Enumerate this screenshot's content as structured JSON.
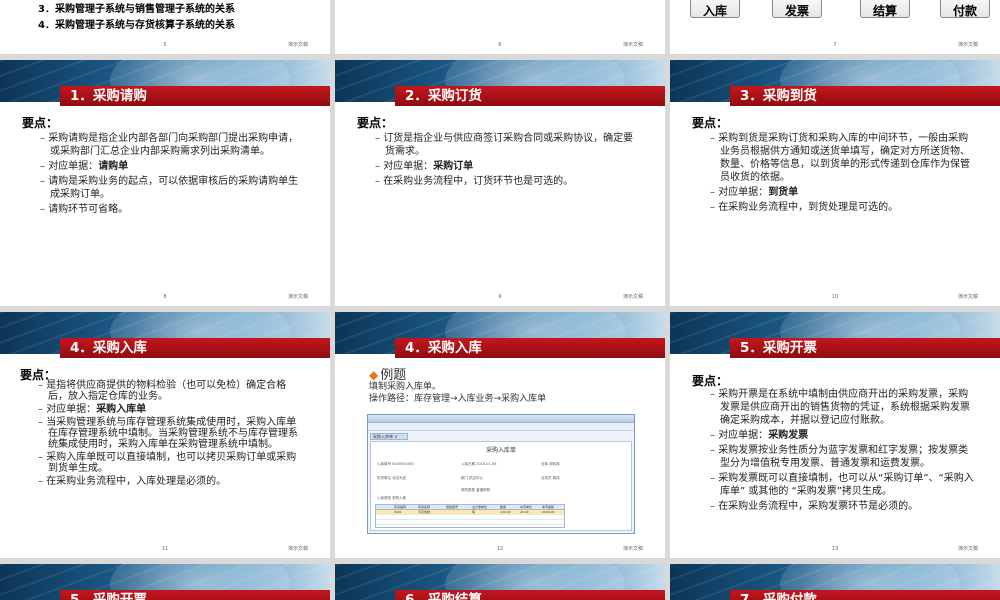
{
  "common": {
    "watermark": "演示文稿"
  },
  "slides": [
    {
      "num": "5",
      "items": [
        "3．采购管理子系统与销售管理子系统的关系",
        "4．采购管理子系统与存货核算子系统的关系"
      ]
    },
    {
      "num": "6"
    },
    {
      "num": "7",
      "process": [
        "入库",
        "发票",
        "结算",
        "付款"
      ]
    },
    {
      "num": "8",
      "title": "1．采购请购",
      "heading": "要点：",
      "points": [
        "采购请购是指企业内部各部门向采购部门提出采购申请，或采购部门汇总企业内部采购需求列出采购清单。",
        "对应单据：",
        "请购单",
        "请购是采购业务的起点，可以依据审核后的采购请购单生成采购订单。",
        "请购环节可省略。"
      ]
    },
    {
      "num": "9",
      "title": "2．采购订货",
      "heading": "要点：",
      "points": [
        "订货是指企业与供应商签订采购合同或采购协议，确定要货需求。",
        "对应单据：",
        "采购订单",
        "在采购业务流程中，订货环节也是可选的。"
      ]
    },
    {
      "num": "10",
      "title": "3．采购到货",
      "heading": "要点：",
      "points": [
        "采购到货是采购订货和采购入库的中间环节，一般由采购业务员根据供方通知或送货单填写，确定对方所送货物、数量、价格等信息，以到货单的形式传递到仓库作为保管员收货的依据。",
        "对应单据：",
        "到货单",
        "在采购业务流程中，到货处理是可选的。"
      ]
    },
    {
      "num": "11",
      "title": "4．采购入库",
      "heading": "要点：",
      "points": [
        "是指将供应商提供的物料检验（也可以免检）确定合格后，放入指定仓库的业务。",
        "对应单据：",
        "采购入库单",
        "当采购管理系统与库存管理系统集成使用时，采购入库单在库存管理系统中填制。当采购管理系统不与库存管理系统集成使用时，采购入库单在采购管理系统中填制。",
        "采购入库单既可以直接填制，也可以拷贝采购订单或采购到货单生成。",
        "在采购业务流程中，入库处理是必须的。"
      ]
    },
    {
      "num": "12",
      "title": "4．采购入库",
      "example": "例题",
      "lines": [
        "填制采购入库单。",
        "操作路径：库存管理→入库业务→采购入库单"
      ],
      "window": {
        "tab": "采购入库单 ×",
        "form_title": "采购入库单",
        "fields": [
          "入库单号 0000000001",
          "入库日期 2016-01-06",
          "仓库 材料库",
          "供货单位 北京天宏",
          "部门 供应中心",
          "业务员 周伟",
          "采购类型 普通采购",
          "入库类别 采购入库"
        ],
        "columns": [
          "存货编码",
          "存货名称",
          "规格型号",
          "主计量单位",
          "数量",
          "本币单价",
          "本币金额"
        ],
        "row": [
          "0001",
          "不定性物",
          "",
          "吨",
          "100.00",
          "20.00",
          "2000.00"
        ]
      }
    },
    {
      "num": "13",
      "title": "5．采购开票",
      "heading": "要点：",
      "points": [
        "采购开票是在系统中填制由供应商开出的采购发票，采购发票是供应商开出的销售货物的凭证，系统根据采购发票确定采购成本，并据以登记应付账款。",
        "对应单据：",
        "采购发票",
        "采购发票按业务性质分为蓝字发票和红字发票；按发票类型分为增值税专用发票、普通发票和运费发票。",
        "采购发票既可以直接填制，也可以从“采购订单”、“采购入库单” 或其他的 “采购发票”拷贝生成。",
        "在采购业务流程中，采购发票环节是必须的。"
      ]
    },
    {
      "title": "5．采购开票"
    },
    {
      "title": "6．采购结算"
    },
    {
      "title": "7．采购付款"
    }
  ]
}
